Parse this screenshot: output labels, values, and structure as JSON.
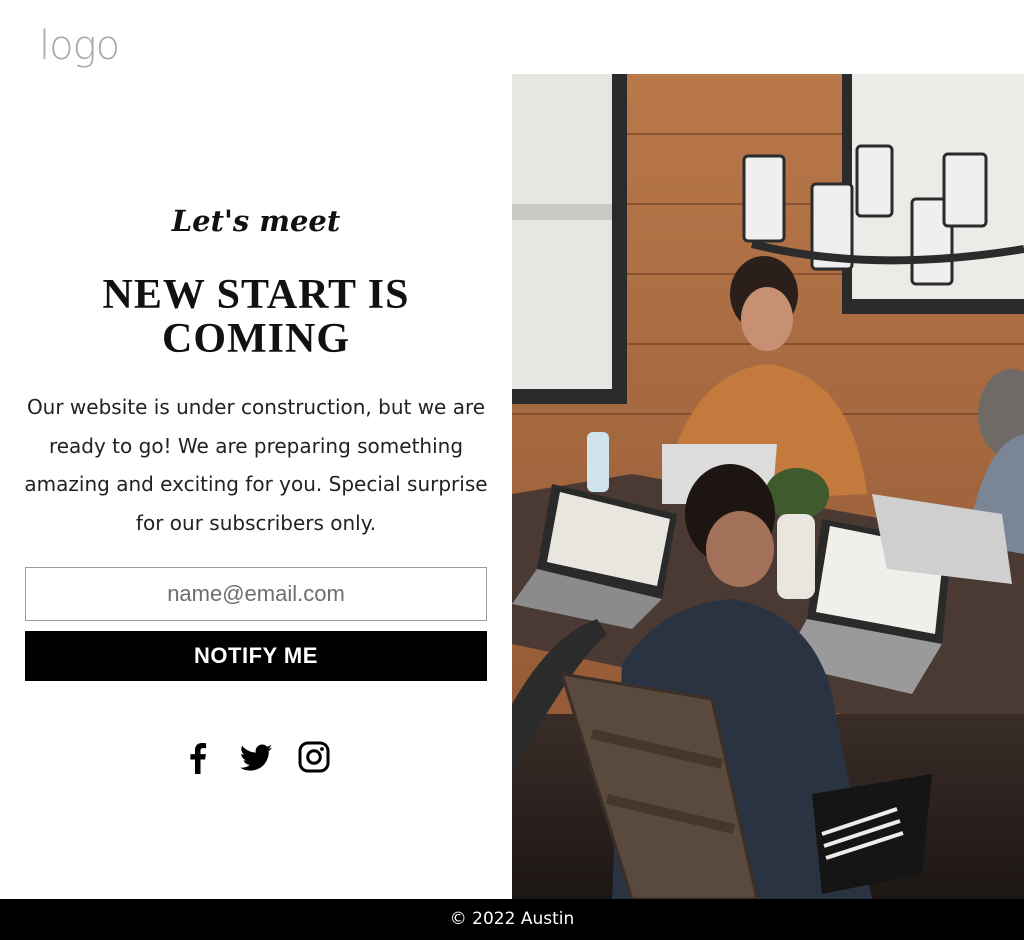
{
  "brand": {
    "logo_text": "logo"
  },
  "hero": {
    "kicker": "Let's meet",
    "headline": "NEW START IS COMING",
    "body": "Our website is under construction, but we are ready to go! We are preparing something amazing and exciting for you. Special surprise for our subscribers only."
  },
  "form": {
    "email_placeholder": "name@email.com",
    "email_value": "",
    "submit_label": "NOTIFY ME"
  },
  "social": {
    "icons": [
      "facebook-icon",
      "twitter-icon",
      "instagram-icon"
    ]
  },
  "footer": {
    "copyright": "© 2022 Austin"
  },
  "colors": {
    "accent": "#000000",
    "text": "#111111",
    "logo": "#a9a9a9",
    "footer_bg": "#000000",
    "footer_text": "#ffffff"
  }
}
